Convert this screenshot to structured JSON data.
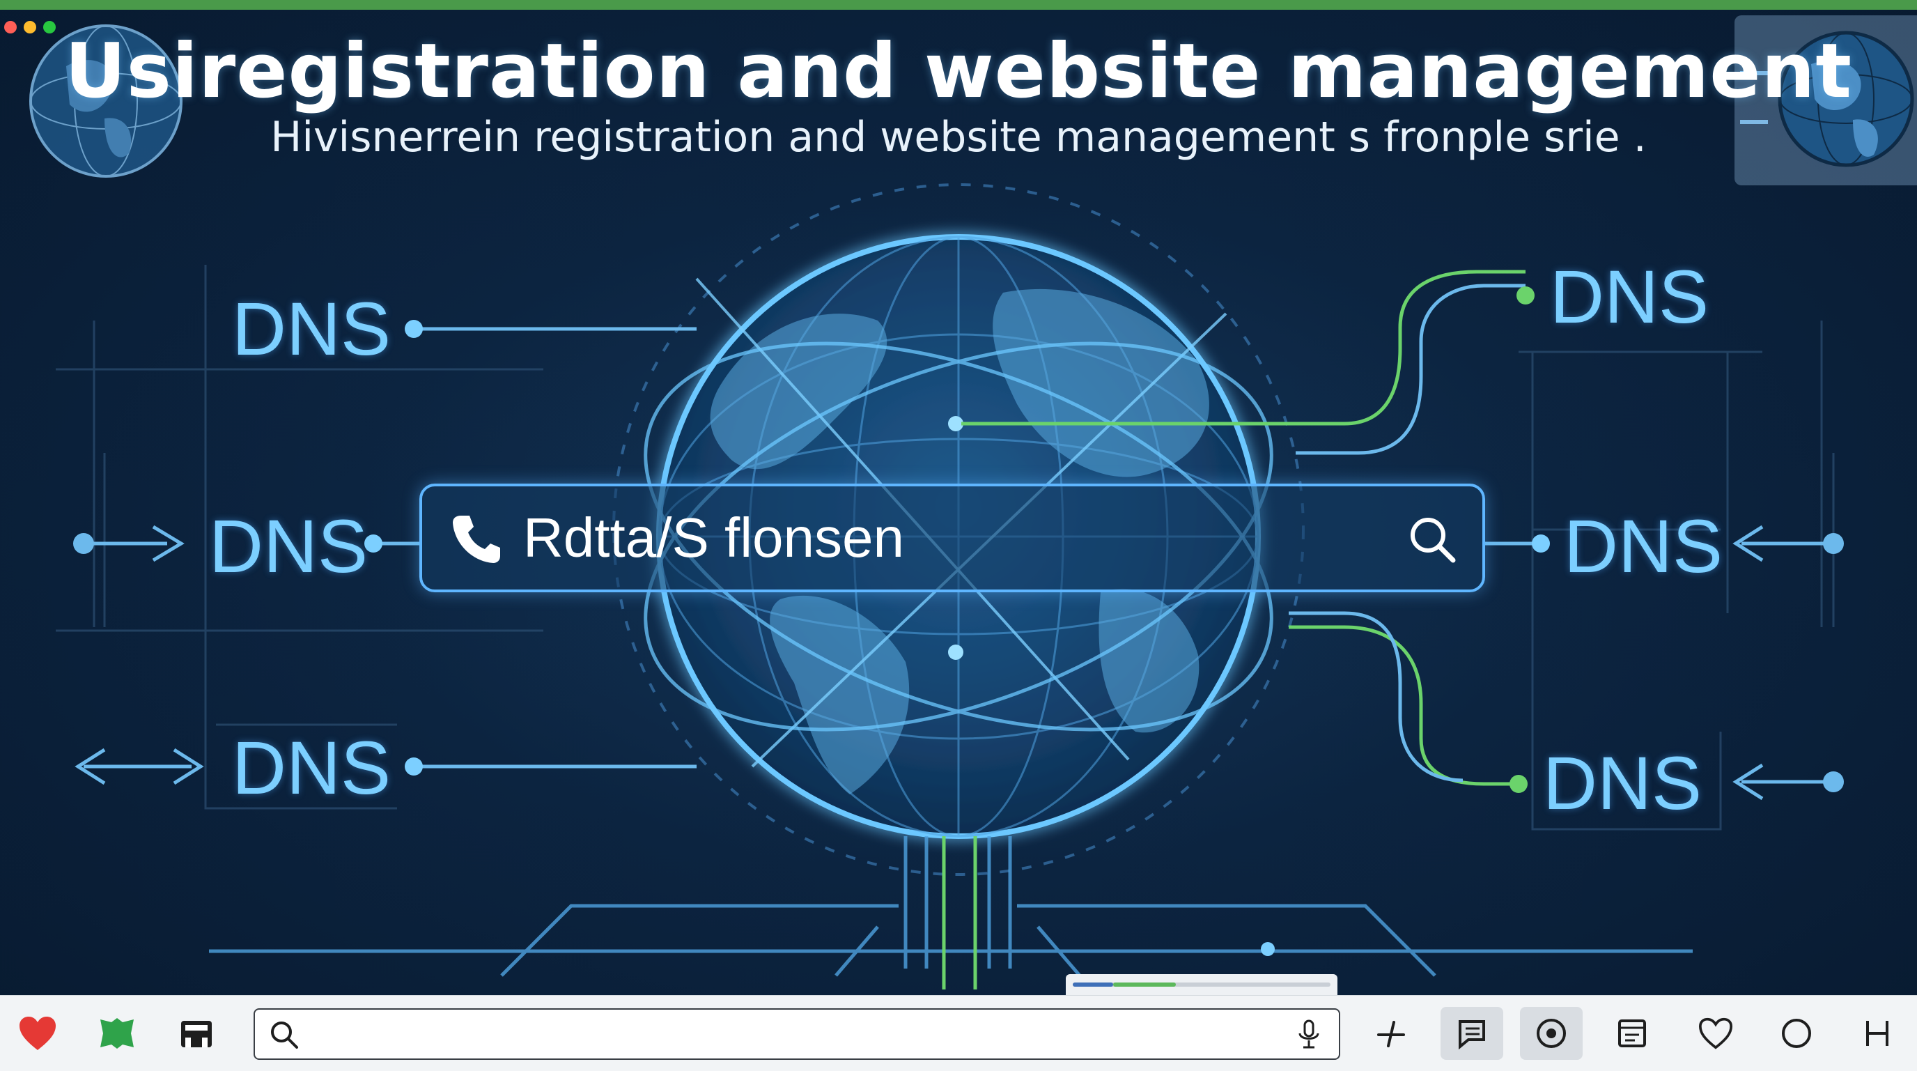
{
  "window": {
    "traffic_lights": [
      "#ff5f57",
      "#febc2e",
      "#28c840"
    ],
    "top_accent": "#4a9a4a"
  },
  "header": {
    "title": "Usiregistration and website management",
    "subtitle": "Hivisnerrein registration and website management s fronple srie ."
  },
  "dns_labels": {
    "left_top": "DNS",
    "left_middle": "DNS",
    "left_bottom": "DNS",
    "right_top": "DNS",
    "right_middle": "DNS",
    "right_bottom": "DNS"
  },
  "search": {
    "value": "Rdtta/S flonsen",
    "icon_left": "phone-icon",
    "icon_right": "search-icon"
  },
  "loading": {
    "progress_percent": 40
  },
  "taskbar": {
    "search_placeholder": "",
    "left_icons": [
      "heart-icon",
      "green-app-icon",
      "dark-app-icon"
    ],
    "right_icons": [
      "pin-icon",
      "list-icon",
      "target-icon",
      "note-icon",
      "heart-outline-icon",
      "circle-icon",
      "h-icon"
    ],
    "active_right": [
      "list-icon",
      "target-icon"
    ],
    "colors": {
      "heart": "#e53935",
      "green": "#2fa34a",
      "dark": "#1e1e1e"
    }
  }
}
